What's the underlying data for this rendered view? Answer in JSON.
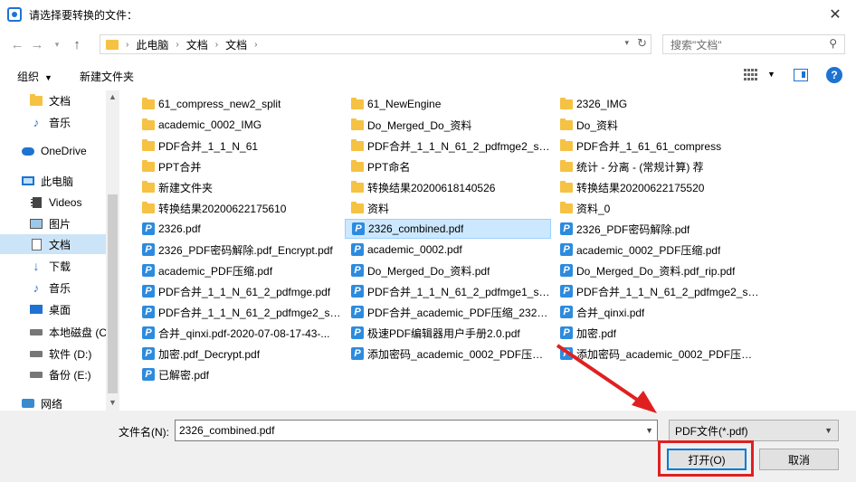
{
  "window": {
    "title": "请选择要转换的文件：",
    "close_glyph": "✕"
  },
  "address": {
    "crumbs": [
      "此电脑",
      "文档",
      "文档"
    ],
    "search_placeholder": "搜索\"文档\""
  },
  "toolbar": {
    "organize": "组织",
    "new_folder": "新建文件夹"
  },
  "nav": {
    "items": [
      {
        "label": "文档",
        "icon": "folder"
      },
      {
        "label": "音乐",
        "icon": "music"
      },
      {
        "label": "OneDrive",
        "icon": "cloud"
      },
      {
        "label": "此电脑",
        "icon": "pc"
      },
      {
        "label": "Videos",
        "icon": "video"
      },
      {
        "label": "图片",
        "icon": "image"
      },
      {
        "label": "文档",
        "icon": "doc",
        "selected": true
      },
      {
        "label": "下载",
        "icon": "down"
      },
      {
        "label": "音乐",
        "icon": "music"
      },
      {
        "label": "桌面",
        "icon": "desk"
      },
      {
        "label": "本地磁盘 (C",
        "icon": "drive"
      },
      {
        "label": "软件 (D:)",
        "icon": "drive"
      },
      {
        "label": "备份 (E:)",
        "icon": "drive"
      },
      {
        "label": "网络",
        "icon": "net"
      }
    ]
  },
  "files": {
    "col1": [
      {
        "name": "61_compress_new2_split",
        "type": "folder"
      },
      {
        "name": "academic_0002_IMG",
        "type": "folder"
      },
      {
        "name": "PDF合并_1_1_N_61",
        "type": "folder"
      },
      {
        "name": "PPT合并",
        "type": "folder"
      },
      {
        "name": "新建文件夹",
        "type": "folder"
      },
      {
        "name": "转换结果20200622175610",
        "type": "folder"
      },
      {
        "name": "2326.pdf",
        "type": "pdf"
      },
      {
        "name": "2326_PDF密码解除.pdf_Encrypt.pdf",
        "type": "pdf"
      },
      {
        "name": "academic_PDF压缩.pdf",
        "type": "pdf"
      },
      {
        "name": "PDF合并_1_1_N_61_2_pdfmge.pdf",
        "type": "pdf"
      },
      {
        "name": "PDF合并_1_1_N_61_2_pdfmge2_sp...",
        "type": "pdf"
      },
      {
        "name": "合并_qinxi.pdf-2020-07-08-17-43-...",
        "type": "pdf"
      },
      {
        "name": "加密.pdf_Decrypt.pdf",
        "type": "pdf"
      },
      {
        "name": "已解密.pdf",
        "type": "pdf"
      }
    ],
    "col2": [
      {
        "name": "61_NewEngine",
        "type": "folder"
      },
      {
        "name": "Do_Merged_Do_资料",
        "type": "folder"
      },
      {
        "name": "PDF合并_1_1_N_61_2_pdfmge2_sp...",
        "type": "folder"
      },
      {
        "name": "PPT命名",
        "type": "folder"
      },
      {
        "name": "转换结果20200618140526",
        "type": "folder"
      },
      {
        "name": "资料",
        "type": "folder"
      },
      {
        "name": "2326_combined.pdf",
        "type": "pdf",
        "selected": true
      },
      {
        "name": "academic_0002.pdf",
        "type": "pdf"
      },
      {
        "name": "Do_Merged_Do_资料.pdf",
        "type": "pdf"
      },
      {
        "name": "PDF合并_1_1_N_61_2_pdfmge1_sp...",
        "type": "pdf"
      },
      {
        "name": "PDF合并_academic_PDF压缩_2326...",
        "type": "pdf"
      },
      {
        "name": "极速PDF编辑器用户手册2.0.pdf",
        "type": "pdf"
      },
      {
        "name": "添加密码_academic_0002_PDF压缩...",
        "type": "pdf"
      }
    ],
    "col3": [
      {
        "name": "2326_IMG",
        "type": "folder"
      },
      {
        "name": "Do_资料",
        "type": "folder"
      },
      {
        "name": "PDF合并_1_61_61_compress",
        "type": "folder"
      },
      {
        "name": "统计 - 分离 - (常规计算) 荐",
        "type": "folder"
      },
      {
        "name": "转换结果20200622175520",
        "type": "folder"
      },
      {
        "name": "资料_0",
        "type": "folder"
      },
      {
        "name": "2326_PDF密码解除.pdf",
        "type": "pdf"
      },
      {
        "name": "academic_0002_PDF压缩.pdf",
        "type": "pdf"
      },
      {
        "name": "Do_Merged_Do_资料.pdf_rip.pdf",
        "type": "pdf"
      },
      {
        "name": "PDF合并_1_1_N_61_2_pdfmge2_sp...",
        "type": "pdf"
      },
      {
        "name": "合并_qinxi.pdf",
        "type": "pdf"
      },
      {
        "name": "加密.pdf",
        "type": "pdf"
      },
      {
        "name": "添加密码_academic_0002_PDF压缩...",
        "type": "pdf"
      }
    ]
  },
  "footer": {
    "filename_label": "文件名(N):",
    "filename_value": "2326_combined.pdf",
    "filetype": "PDF文件(*.pdf)",
    "open": "打开(O)",
    "cancel": "取消"
  },
  "colors": {
    "accent": "#0078d7",
    "highlight": "#e02020",
    "selection": "#cce8ff",
    "folder": "#f5c244"
  }
}
